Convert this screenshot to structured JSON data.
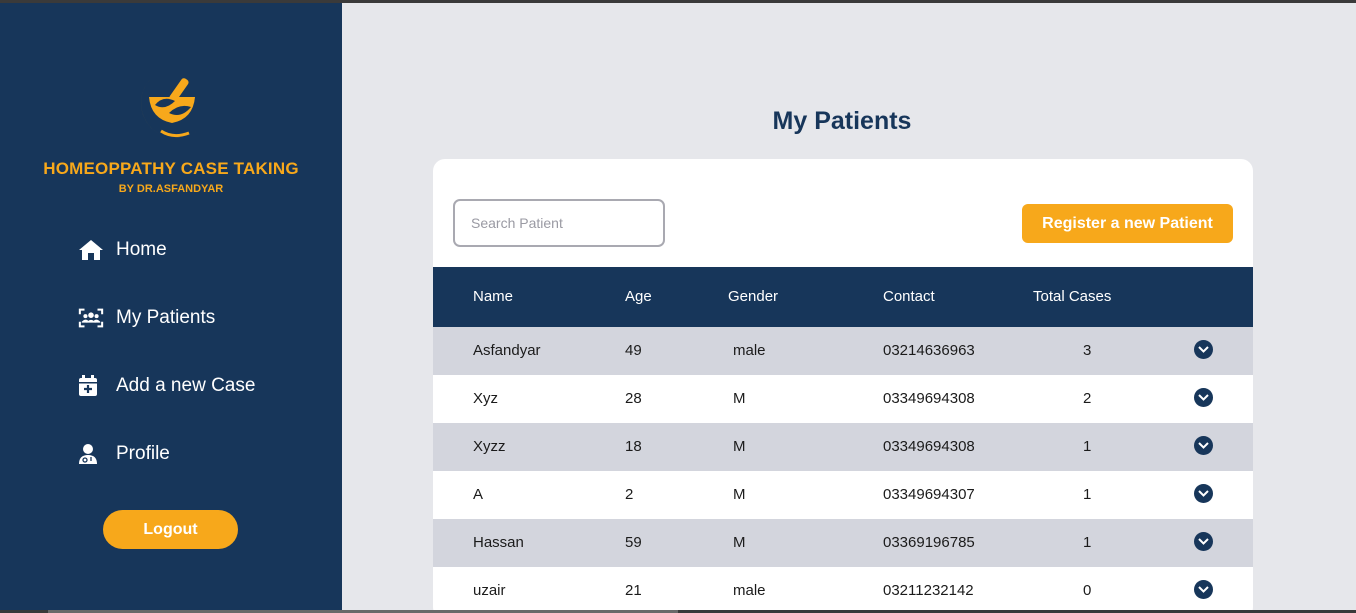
{
  "brand": {
    "title": "HOMEOPPATHY CASE TAKING",
    "subtitle": "BY DR.ASFANDYAR",
    "logo_icon": "mortar-pestle-leaf-icon"
  },
  "nav": {
    "home": "Home",
    "patients": "My Patients",
    "add_case": "Add a new Case",
    "profile": "Profile",
    "logout": "Logout"
  },
  "page": {
    "title": "My Patients"
  },
  "search": {
    "placeholder": "Search Patient",
    "value": ""
  },
  "actions": {
    "register": "Register a new Patient"
  },
  "table": {
    "headers": {
      "name": "Name",
      "age": "Age",
      "gender": "Gender",
      "contact": "Contact",
      "cases": "Total Cases"
    },
    "rows": [
      {
        "name": "Asfandyar",
        "age": "49",
        "gender": "male",
        "contact": "03214636963",
        "cases": "3"
      },
      {
        "name": "Xyz",
        "age": "28",
        "gender": "M",
        "contact": "03349694308",
        "cases": "2"
      },
      {
        "name": "Xyzz",
        "age": "18",
        "gender": "M",
        "contact": "03349694308",
        "cases": "1"
      },
      {
        "name": "A",
        "age": "2",
        "gender": "M",
        "contact": "03349694307",
        "cases": "1"
      },
      {
        "name": "Hassan",
        "age": "59",
        "gender": "M",
        "contact": "03369196785",
        "cases": "1"
      },
      {
        "name": "uzair",
        "age": "21",
        "gender": "male",
        "contact": "03211232142",
        "cases": "0"
      }
    ]
  },
  "colors": {
    "navy": "#17365a",
    "accent": "#f7a81b",
    "background": "#e6e7eb",
    "row_shade": "#d3d5dd"
  }
}
